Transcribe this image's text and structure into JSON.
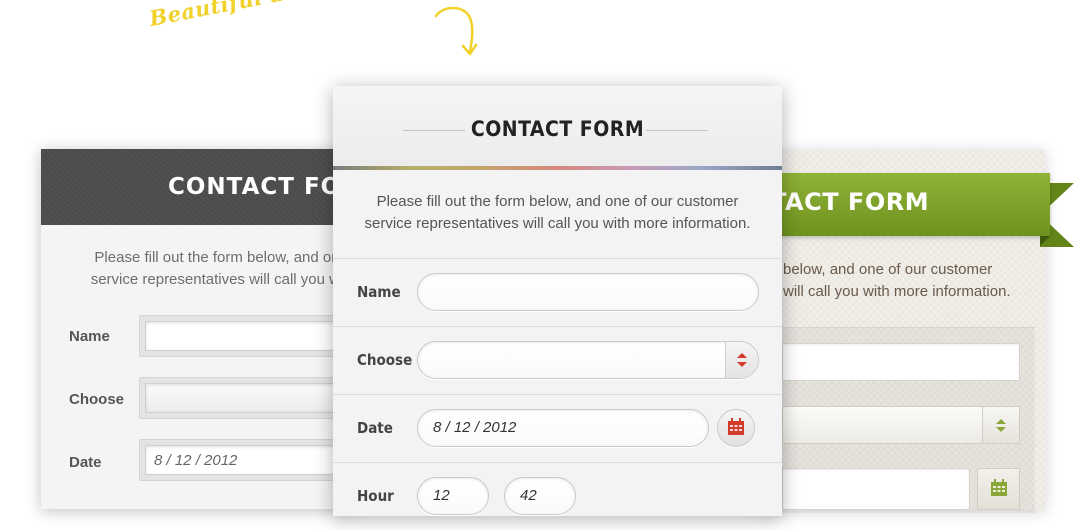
{
  "tagline": "Beautiful and Elegant Forms",
  "left_form": {
    "title": "CONTACT FO",
    "intro_line1": "Please fill out the form below, and on",
    "intro_line2": "service representatives will call you wi",
    "name_label": "Name",
    "choose_label": "Choose",
    "date_label": "Date",
    "date_value": "8 / 12 / 2012"
  },
  "middle_form": {
    "title": "CONTACT FORM",
    "intro_line1": "Please fill out the form below, and one of our customer",
    "intro_line2": "service representatives will call you with more information.",
    "name_label": "Name",
    "name_value": "",
    "choose_label": "Choose",
    "choose_value": "",
    "date_label": "Date",
    "date_value": "8 / 12 / 2012",
    "hour_label": "Hour",
    "hour_value": "12",
    "minute_value": "42"
  },
  "right_form": {
    "title": "TACT FORM",
    "intro_line1": "below, and one of our customer",
    "intro_line2": "will call you with more information."
  },
  "colors": {
    "accent_red": "#d23a2a",
    "ribbon_green": "#7fa22a",
    "tagline_yellow": "#f1d22a",
    "dark_header": "#4a4b4d"
  },
  "icons": {
    "arrow": "curved-arrow-icon",
    "calendar": "calendar-icon",
    "select_spinner": "up-down-arrows-icon"
  }
}
